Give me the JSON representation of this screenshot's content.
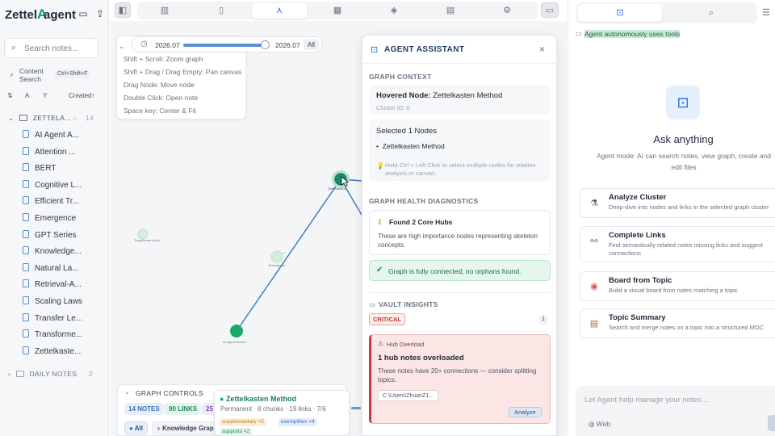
{
  "app": {
    "brand_prefix": "Zettel",
    "brand_suffix": "agent"
  },
  "sidebar": {
    "search_placeholder": "Search notes...",
    "content_search_line1": "Content",
    "content_search_line2": "Search",
    "content_search_shortcut": "Ctrl+Shift+F",
    "sort_label": "Created",
    "sort_arrow": "↑",
    "folder_label": "ZETTELA...",
    "folder_count": "14",
    "notes": [
      "AI Agent A...",
      "Attention ...",
      "BERT",
      "Cognitive L...",
      "Efficient Tr...",
      "Emergence",
      "GPT Series",
      "Knowledge...",
      "Natural La...",
      "Retrieval-A...",
      "Scaling Laws",
      "Transfer Le...",
      "Transforme...",
      "Zettelkaste..."
    ],
    "daily_label": "DAILY NOTES",
    "daily_count": "2"
  },
  "help": {
    "lines": [
      "Shift + Scroll: Zoom graph",
      "Shift + Drag / Drag Empty: Pan canvas",
      "Drag Node: Move node",
      "Double Click: Open note",
      "Space key: Center & Fit"
    ]
  },
  "timeline": {
    "start": "2026.07",
    "end": "2026.07",
    "all": "All",
    "position": 1.0
  },
  "graph": {
    "nodes": [
      {
        "label": "Zettelkasten Method",
        "short": "Zettelkasten..."
      },
      {
        "label": "Emergence",
        "short": "Emergence"
      },
      {
        "label": "AI Agent Architecture",
        "short": "AI Agent Archite..."
      },
      {
        "label": "Transformer Architecture",
        "short": "Transformer Archi..."
      }
    ]
  },
  "graph_controls": {
    "title": "GRAPH CONTROLS",
    "notes": "14 NOTES",
    "links": "90 LINKS",
    "third_partial": "25",
    "all": "All",
    "knowledge_partial": "Knowledge Grap"
  },
  "hover_tip": {
    "title": "Zettelkasten Method",
    "meta": "Permanent · 8 chunks · 19 links · 7/6",
    "tags": [
      "supplementary ×5",
      "exemplifies ×4",
      "supports ×2"
    ]
  },
  "assistant": {
    "title": "AGENT ASSISTANT",
    "graph_context": "GRAPH CONTEXT",
    "hovered_label": "Hovered Node:",
    "hovered_value": "Zettelkasten Method",
    "cluster": "Cluster ID: 0",
    "selected_title": "Selected 1 Nodes",
    "selected_item": "Zettelkasten Method",
    "hint": "Hold Ctrl + Left Click to select multiple nodes for relation analysis or canvas.",
    "health_title": "GRAPH HEALTH DIAGNOSTICS",
    "hubs_title": "Found 2 Core Hubs",
    "hubs_desc": "These are high importance nodes representing skeleton concepts.",
    "connected": "Graph is fully connected, no orphans found.",
    "vault_title": "VAULT INSIGHTS",
    "critical": "CRITICAL",
    "critical_count": "1",
    "overload_label": "Hub Overload",
    "overload_title": "1 hub notes overloaded",
    "overload_desc": "These notes have 20+ connections — consider splitting topics.",
    "path": "C:\\Users\\ZhuanZ1...",
    "analyze": "Analyze"
  },
  "right_panel": {
    "banner": "Agent autonomously uses tools",
    "ask_title": "Ask anything",
    "ask_sub": "Agent mode: AI can search notes, view graph, create and edit files",
    "actions": [
      {
        "title": "Analyze Cluster",
        "desc": "Deep-dive into nodes and links in the selected graph cluster",
        "icon": "analyze-icon"
      },
      {
        "title": "Complete Links",
        "desc": "Find semantically related notes missing links and suggest connections",
        "icon": "link-icon"
      },
      {
        "title": "Board from Topic",
        "desc": "Build a visual board from notes matching a topic",
        "icon": "palette-icon"
      },
      {
        "title": "Topic Summary",
        "desc": "Search and merge notes on a topic into a structured MOC",
        "icon": "summary-icon"
      }
    ],
    "input_placeholder": "Let Agent help manage your notes...",
    "web_label": "Web"
  },
  "colors": {
    "accent": "#0d9f6e",
    "node": "#1aa86b",
    "critical": "#d03a3a",
    "link": "#2f6fb5"
  }
}
